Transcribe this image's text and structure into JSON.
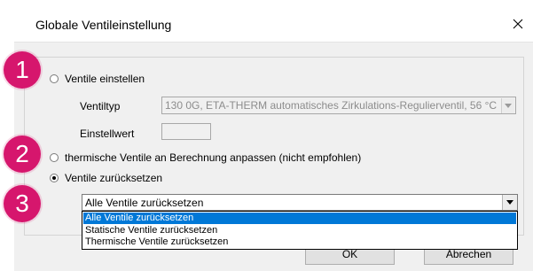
{
  "dialog": {
    "title": "Globale Ventileinstellung",
    "close_glyph": "✕"
  },
  "options": {
    "ventile_einstellen": {
      "label": "Ventile einstellen",
      "ventiltyp_label": "Ventiltyp",
      "ventiltyp_value": "130 0G, ETA-THERM automatisches Zirkulations-Regulierventil, 56 °C",
      "einstellwert_label": "Einstellwert",
      "einstellwert_value": ""
    },
    "thermische": {
      "label": "thermische Ventile an Berechnung anpassen (nicht empfohlen)"
    },
    "zuruecksetzen": {
      "label": "Ventile zurücksetzen"
    }
  },
  "combo": {
    "selected": "Alle Ventile zurücksetzen",
    "arrow_glyph": "▼",
    "items": [
      "Alle Ventile zurücksetzen",
      "Statische Ventile zurücksetzen",
      "Thermische Ventile zurücksetzen"
    ]
  },
  "buttons": {
    "ok": "OK",
    "cancel": "Abrechen"
  },
  "badges": [
    "1",
    "2",
    "3"
  ],
  "colors": {
    "badge": "#d6166d",
    "selection": "#0078d7"
  }
}
